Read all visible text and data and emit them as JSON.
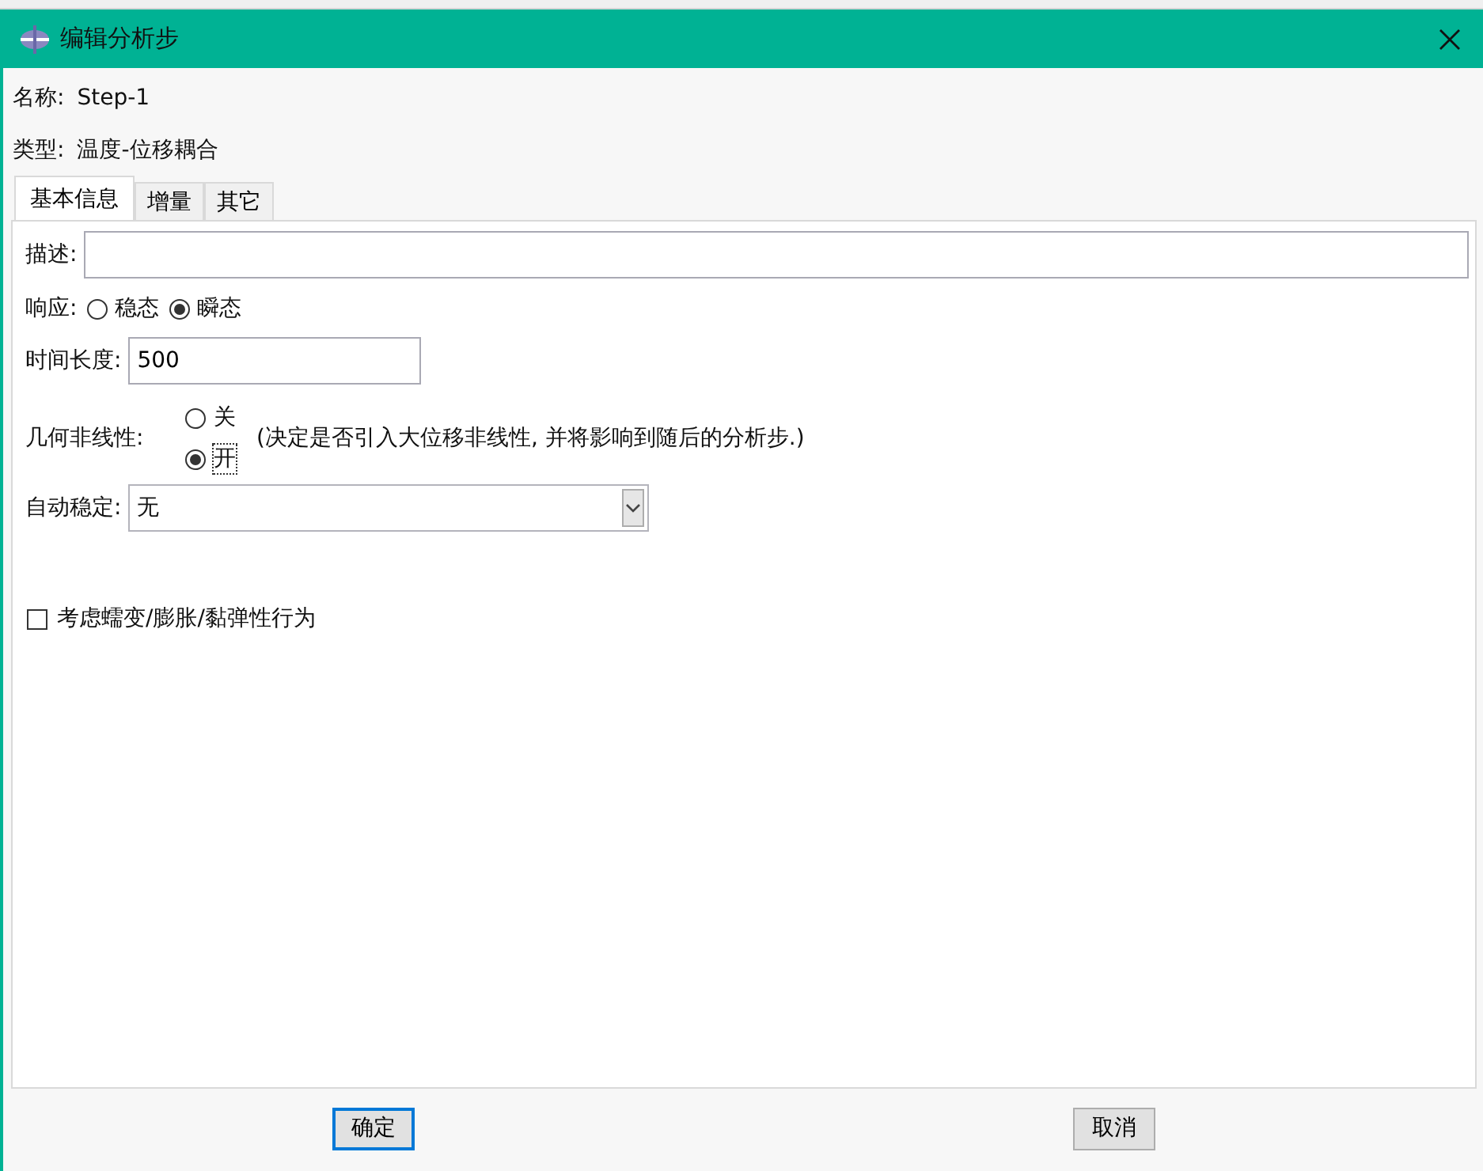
{
  "window": {
    "title": "编辑分析步"
  },
  "name": {
    "label": "名称:",
    "value": "Step-1"
  },
  "type": {
    "label": "类型:",
    "value": "温度-位移耦合"
  },
  "tabs": [
    {
      "label": "基本信息",
      "selected": true
    },
    {
      "label": "增量",
      "selected": false
    },
    {
      "label": "其它",
      "selected": false
    }
  ],
  "description": {
    "label": "描述:"
  },
  "response": {
    "label": "响应:",
    "options": [
      {
        "label": "稳态",
        "selected": false
      },
      {
        "label": "瞬态",
        "selected": true
      }
    ]
  },
  "time_period": {
    "label": "时间长度:",
    "value": "500"
  },
  "nlgeom": {
    "label": "几何非线性:",
    "options": [
      {
        "label": "关",
        "selected": false
      },
      {
        "label": "开",
        "selected": true
      }
    ],
    "note": "(决定是否引入大位移非线性, 并将影响到随后的分析步.)"
  },
  "stabilization": {
    "label": "自动稳定:",
    "value": "无"
  },
  "creep": {
    "label": "考虑蠕变/膨胀/黏弹性行为",
    "checked": false
  },
  "buttons": [
    "确定",
    "取消"
  ]
}
